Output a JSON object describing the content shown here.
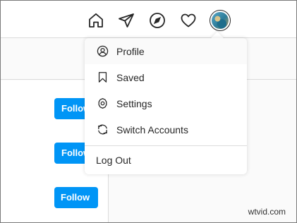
{
  "nav": {
    "icons": [
      "home-icon",
      "direct-messages-icon",
      "explore-icon",
      "activity-heart-icon"
    ],
    "profile_avatar": "profile-avatar"
  },
  "follow_buttons": [
    "Follow",
    "Follow",
    "Follow"
  ],
  "menu": {
    "items": [
      {
        "label": "Profile",
        "icon": "profile-icon"
      },
      {
        "label": "Saved",
        "icon": "bookmark-icon"
      },
      {
        "label": "Settings",
        "icon": "settings-gear-icon"
      },
      {
        "label": "Switch Accounts",
        "icon": "switch-accounts-icon"
      }
    ],
    "logout_label": "Log Out"
  },
  "watermark": "wtvid.com",
  "colors": {
    "accent": "#0095f6",
    "border": "#dbdbdb",
    "text": "#262626",
    "background": "#fafafa"
  }
}
